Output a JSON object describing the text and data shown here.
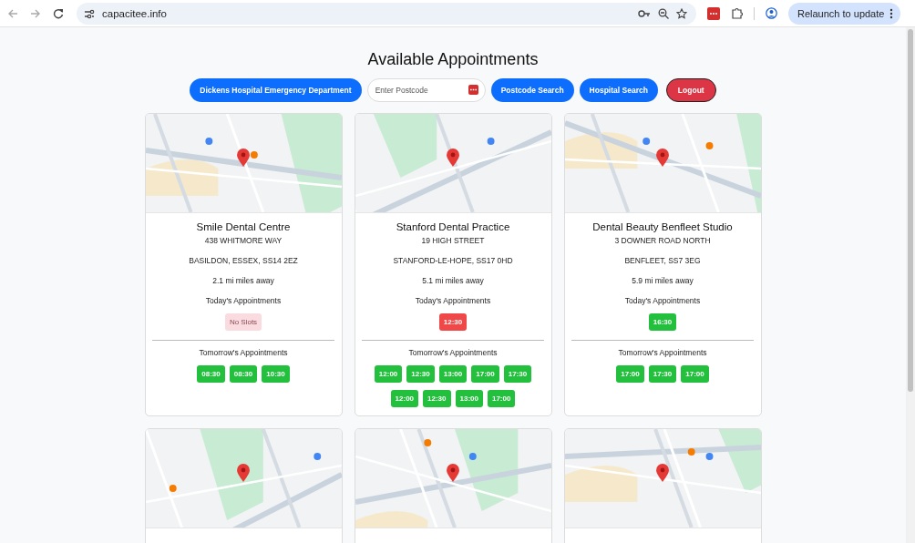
{
  "browser": {
    "url": "capacitee.info",
    "update_button": "Relaunch to update"
  },
  "title": "Available Appointments",
  "toolbar": {
    "hospital_button": "Dickens Hospital Emergency Department",
    "postcode": {
      "placeholder": "Enter Postcode"
    },
    "postcode_button": "Postcode Search",
    "hospital_search_button": "Hospital Search",
    "logout_button": "Logout"
  },
  "clinics": [
    {
      "map": {
        "kind": "picture"
      },
      "name": "Smile Dental Centre",
      "address_line_1": "438 WHITMORE WAY",
      "address_line_2": "BASILDON, ESSEX, SS14 2EZ",
      "distance": "2.1 mi miles away",
      "today_label": "Today's Appointments",
      "today": [
        {
          "time": "No Slots",
          "color": "#fadbe0"
        }
      ],
      "tomorrow_label": "Tomorrow's Appointments",
      "tomorrow": [
        {
          "time": "08:30",
          "color": "#22c03c"
        },
        {
          "time": "08:30",
          "color": "#22c03c"
        },
        {
          "time": "10:30",
          "color": "#22c03c"
        }
      ]
    },
    {
      "map": {
        "kind": "picture"
      },
      "name": "Stanford Dental Practice",
      "address_line_1": "19 HIGH STREET",
      "address_line_2": "STANFORD-LE-HOPE, SS17 0HD",
      "distance": "5.1 mi miles away",
      "today_label": "Today's Appointments",
      "today": [
        {
          "time": "12:30",
          "color": "#f04848"
        }
      ],
      "tomorrow_label": "Tomorrow's Appointments",
      "tomorrow": [
        {
          "time": "12:00",
          "color": "#22c03c"
        },
        {
          "time": "12:30",
          "color": "#22c03c"
        },
        {
          "time": "13:00",
          "color": "#22c03c"
        },
        {
          "time": "17:00",
          "color": "#22c03c"
        },
        {
          "time": "17:30",
          "color": "#22c03c"
        },
        {
          "time": "12:00",
          "color": "#22c03c"
        },
        {
          "time": "12:30",
          "color": "#22c03c"
        },
        {
          "time": "13:00",
          "color": "#22c03c"
        },
        {
          "time": "17:00",
          "color": "#22c03c"
        }
      ]
    },
    {
      "map": {
        "kind": "picture"
      },
      "name": "Dental Beauty Benfleet Studio",
      "address_line_1": "3 DOWNER ROAD NORTH",
      "address_line_2": "BENFLEET, SS7 3EG",
      "distance": "5.9 mi miles away",
      "today_label": "Today's Appointments",
      "today": [
        {
          "time": "16:30",
          "color": "#22c03c"
        }
      ],
      "tomorrow_label": "Tomorrow's Appointments",
      "tomorrow": [
        {
          "time": "17:00",
          "color": "#22c03c"
        },
        {
          "time": "17:30",
          "color": "#22c03c"
        },
        {
          "time": "17:00",
          "color": "#22c03c"
        }
      ]
    },
    {
      "map": {
        "kind": "picture"
      }
    },
    {
      "map": {
        "kind": "picture"
      }
    },
    {
      "map": {
        "kind": "picture"
      }
    }
  ]
}
